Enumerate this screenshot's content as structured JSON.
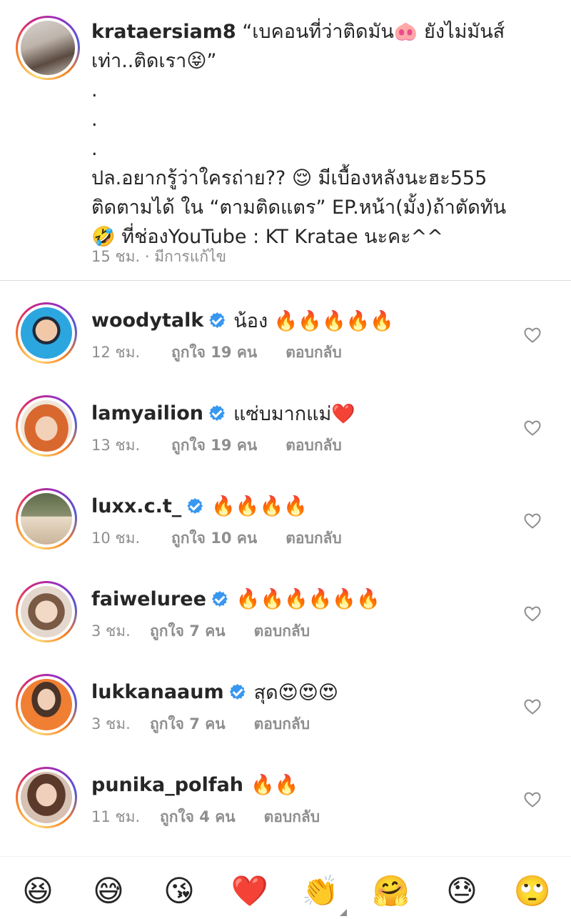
{
  "caption": {
    "username": "krataersiam8",
    "lines": [
      "“เบคอนที่ว่าติดมัน🐽 ยังไม่มันส์",
      "เท่า..ติดเรา😝”",
      ".",
      ".",
      ".",
      "ปล.อยากรู้ว่าใครถ่าย?? 😌 มีเบื้องหลังนะฮะ555",
      "ติดตามได้ ใน “ตามติดแตร” EP.หน้า(มั้ง)ถ้าตัดทัน",
      "🤣 ที่ช่องYouTube : KT Kratae นะคะ^^"
    ],
    "meta": "15 ชม. · มีการแก้ไข"
  },
  "comments": [
    {
      "username": "woodytalk",
      "text": "น้อง 🔥🔥🔥🔥🔥",
      "time": "12 ชม.",
      "likes": "ถูกใจ 19 คน",
      "reply": "ตอบกลับ",
      "avatar_color": "#29a9e1"
    },
    {
      "username": "lamyailion",
      "text": "แซ่บมากแม่❤️",
      "time": "13 ชม.",
      "likes": "ถูกใจ 19 คน",
      "reply": "ตอบกลับ",
      "avatar_color": "#e07a3c"
    },
    {
      "username": "luxx.c.t_",
      "text": "🔥🔥🔥🔥",
      "time": "10 ชม.",
      "likes": "ถูกใจ 10 คน",
      "reply": "ตอบกลับ",
      "avatar_color": "#8f8a6a"
    },
    {
      "username": "faiweluree",
      "text": "🔥🔥🔥🔥🔥🔥",
      "time": "3 ชม.",
      "likes": "ถูกใจ 7 คน",
      "reply": "ตอบกลับ",
      "avatar_color": "#c9b7a8"
    },
    {
      "username": "lukkanaaum",
      "text": "สุด😍😍😍",
      "time": "3 ชม.",
      "likes": "ถูกใจ 7 คน",
      "reply": "ตอบกลับ",
      "avatar_color": "#f08a3b"
    },
    {
      "username": "punika_polfah",
      "text": "🔥🔥",
      "time": "11 ชม.",
      "likes": "ถูกใจ 4 คน",
      "reply": "ตอบกลับ",
      "avatar_color": "#b9866e"
    }
  ],
  "emoji_bar": [
    "😆",
    "😅",
    "😘",
    "❤️",
    "👏",
    "🤗",
    "😓",
    "🙄"
  ],
  "icons": {
    "like": "heart-outline-icon",
    "verified": "verified-badge-icon"
  }
}
